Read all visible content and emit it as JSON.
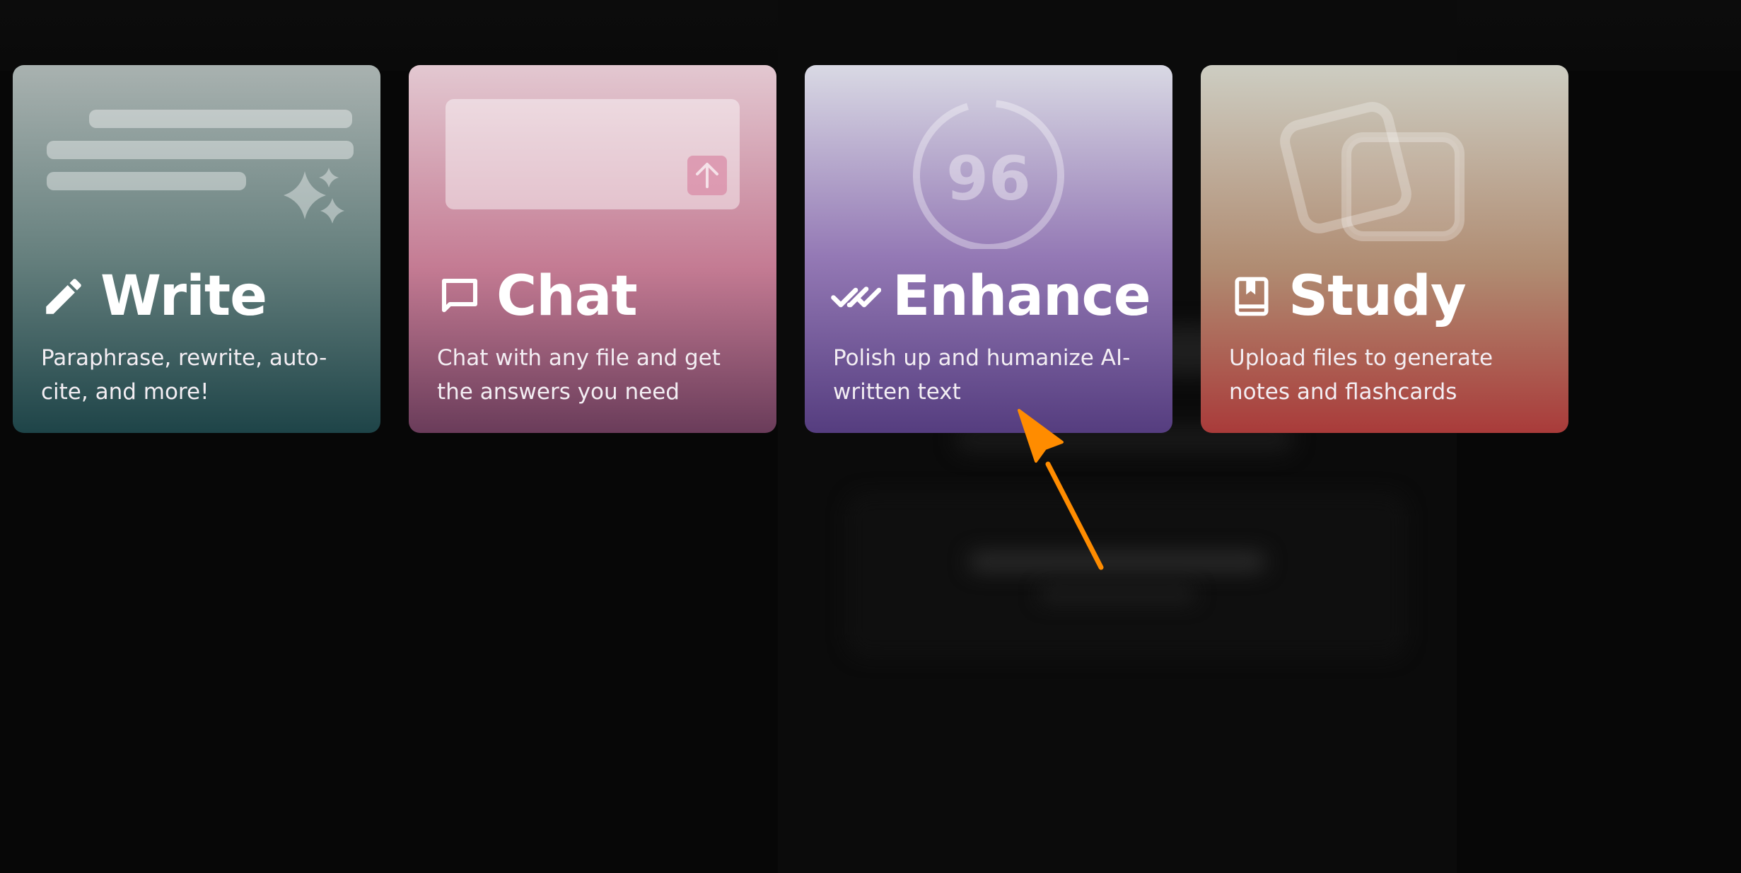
{
  "cards": [
    {
      "title": "Write",
      "description": "Paraphrase, rewrite, auto-cite, and more!",
      "icon": "pencil-icon",
      "illustration": "text-lines-sparkle"
    },
    {
      "title": "Chat",
      "description": "Chat with any file and get the answers you need",
      "icon": "chat-bubble-icon",
      "illustration": "chat-input-with-upload-arrow"
    },
    {
      "title": "Enhance",
      "description": "Polish up and humanize AI-written text",
      "icon": "double-check-icon",
      "illustration": "score-ring",
      "score": "96"
    },
    {
      "title": "Study",
      "description": "Upload files to generate notes and flashcards",
      "icon": "book-icon",
      "illustration": "stacked-cards"
    }
  ],
  "annotation": {
    "type": "arrow",
    "color": "#ff8c00",
    "points_to": "Enhance card"
  },
  "colors": {
    "background": "#070707",
    "write_card_bottom": "#1e4448",
    "chat_card_bottom": "#6a3c5a",
    "enhance_card_bottom": "#553d7f",
    "study_card_bottom": "#a93b3a"
  }
}
